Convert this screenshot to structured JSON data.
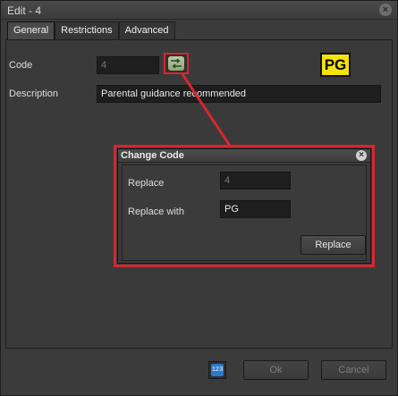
{
  "window": {
    "title": "Edit - 4",
    "close_glyph": "×"
  },
  "tabs": [
    {
      "label": "General",
      "active": true
    },
    {
      "label": "Restrictions",
      "active": false
    },
    {
      "label": "Advanced",
      "active": false
    }
  ],
  "general": {
    "code_label": "Code",
    "code_value": "4",
    "description_label": "Description",
    "description_value": "Parental guidance recommended",
    "badge_text": "PG",
    "swap_icon": "swap-arrows-icon"
  },
  "change_code_dialog": {
    "title": "Change Code",
    "close_glyph": "×",
    "replace_label": "Replace",
    "replace_value": "4",
    "replace_with_label": "Replace with",
    "replace_with_value": "PG",
    "replace_button": "Replace"
  },
  "footer": {
    "icon_text": "123",
    "ok_button": "Ok",
    "cancel_button": "Cancel"
  },
  "colors": {
    "highlight": "#d62630",
    "badge": "#f4e20b",
    "background": "#3a3a3a"
  }
}
